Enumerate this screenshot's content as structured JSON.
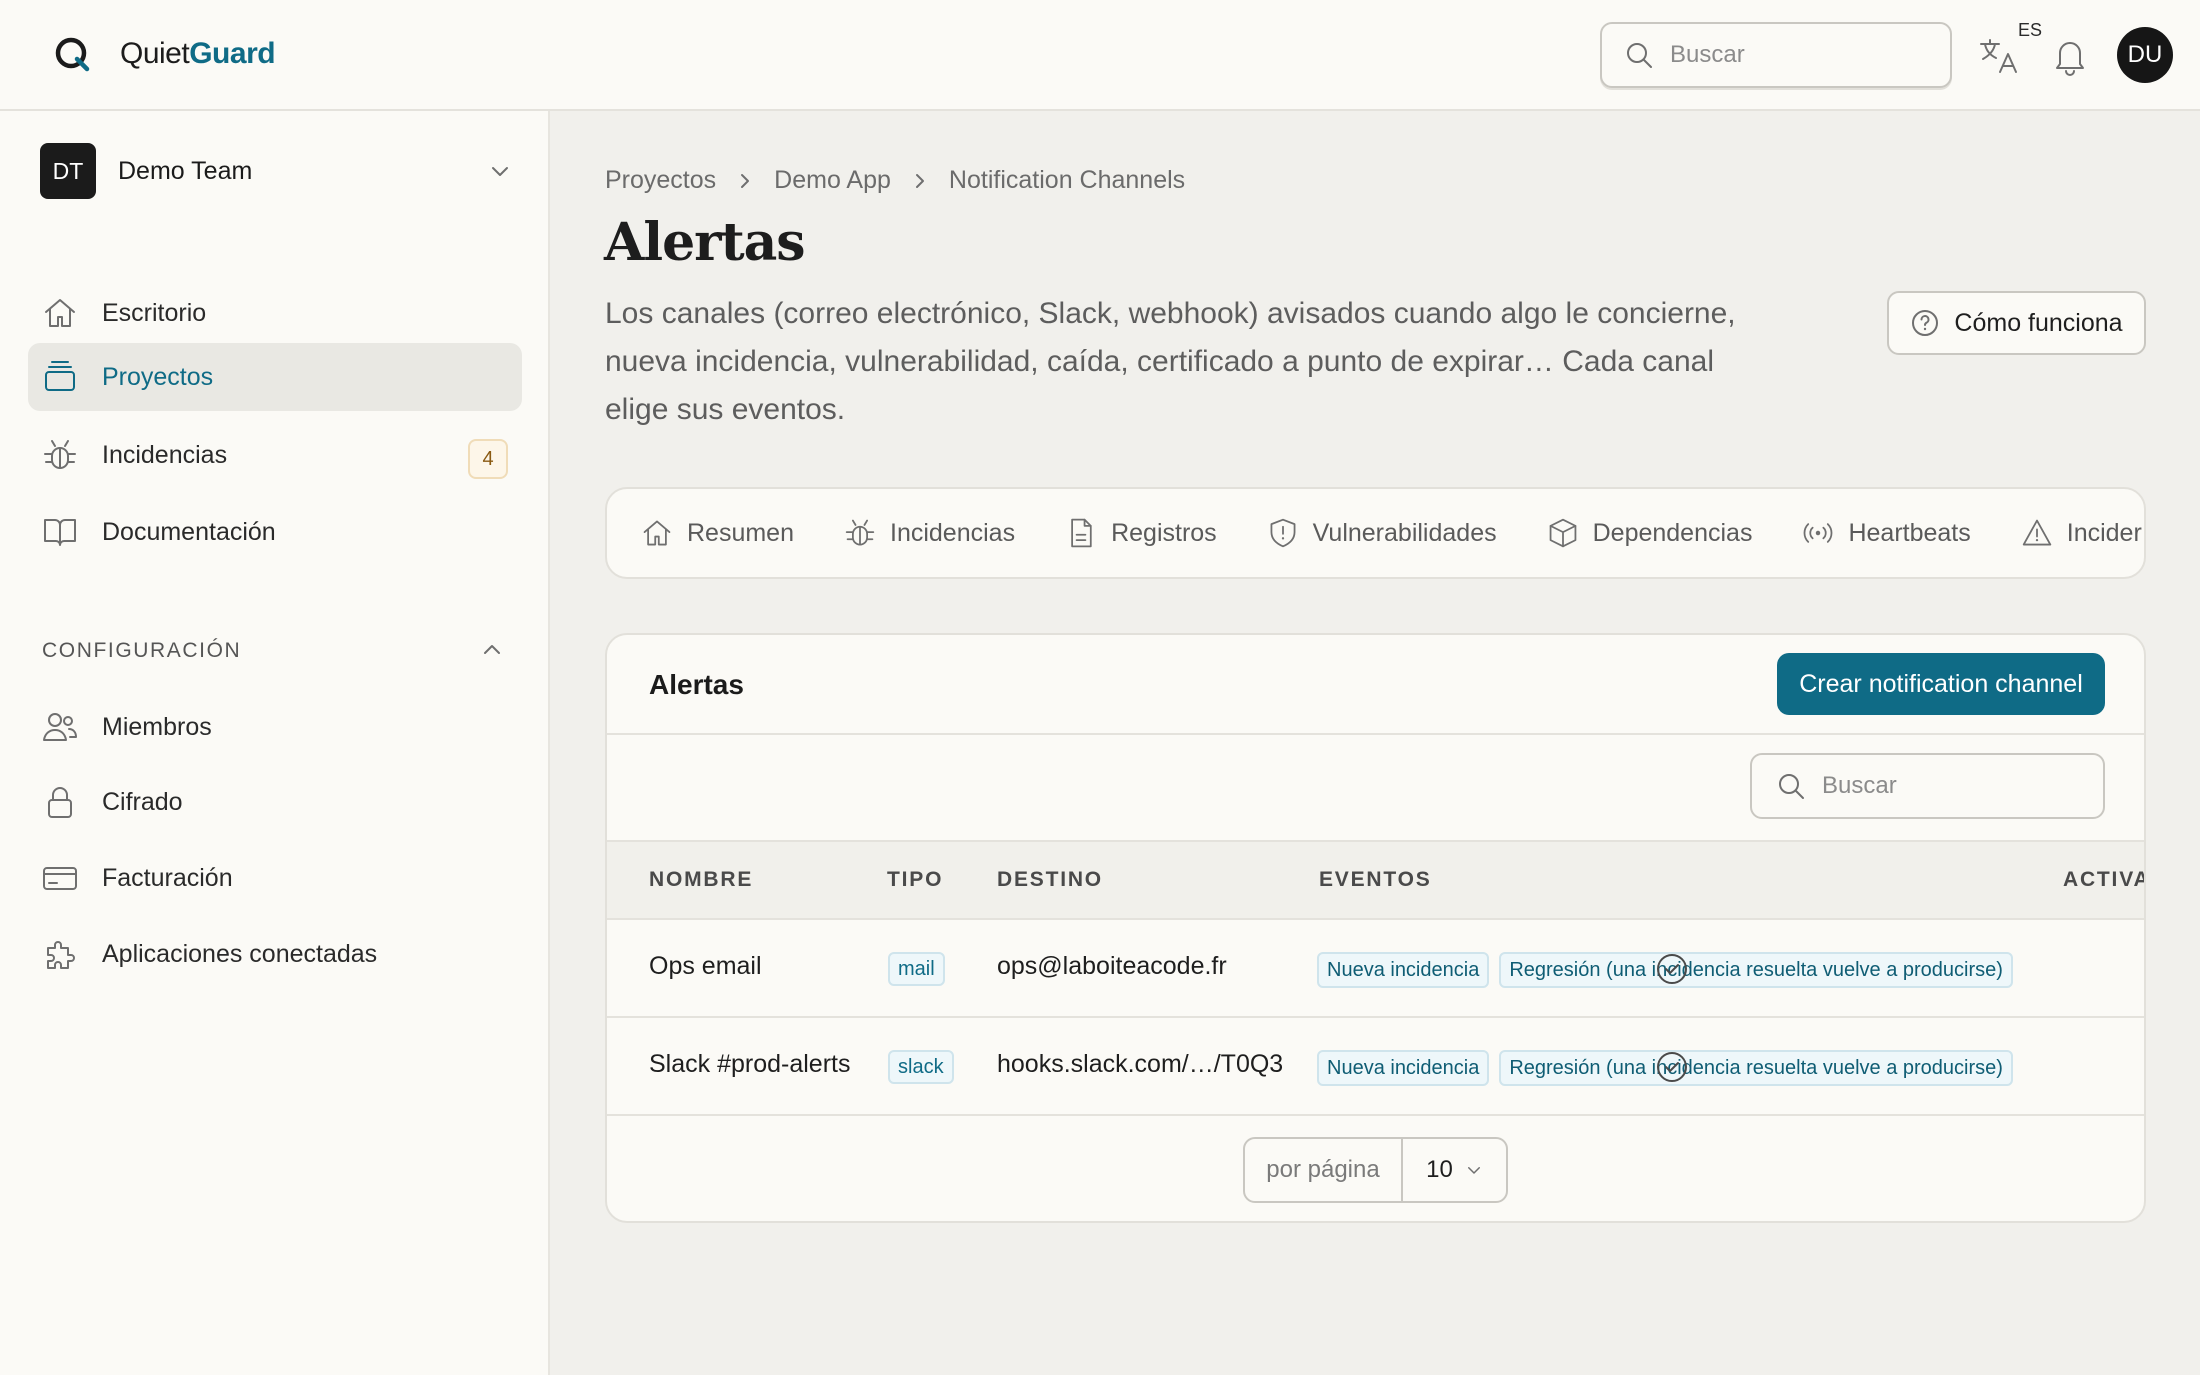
{
  "header": {
    "brand_prefix": "Quiet",
    "brand_suffix": "Guard",
    "search_placeholder": "Buscar",
    "language_code": "ES",
    "user_initials": "DU"
  },
  "sidebar": {
    "team_initials": "DT",
    "team_name": "Demo Team",
    "nav": [
      {
        "label": "Escritorio",
        "icon": "home-icon"
      },
      {
        "label": "Proyectos",
        "icon": "projects-icon",
        "active": true
      },
      {
        "label": "Incidencias",
        "icon": "bug-icon",
        "badge": "4"
      },
      {
        "label": "Documentación",
        "icon": "book-icon"
      }
    ],
    "config_title": "CONFIGURACIÓN",
    "config_items": [
      {
        "label": "Miembros",
        "icon": "members-icon"
      },
      {
        "label": "Cifrado",
        "icon": "lock-icon"
      },
      {
        "label": "Facturación",
        "icon": "credit-card-icon"
      },
      {
        "label": "Aplicaciones conectadas",
        "icon": "puzzle-icon"
      }
    ]
  },
  "main": {
    "breadcrumb": [
      "Proyectos",
      "Demo App",
      "Notification Channels"
    ],
    "title": "Alertas",
    "description": "Los canales (correo electrónico, Slack, webhook) avisados cuando algo le concierne, nueva incidencia, vulnerabilidad, caída, certificado a punto de expirar… Cada canal elige sus eventos.",
    "how_it_works_label": "Cómo funciona",
    "tabs": [
      {
        "label": "Resumen",
        "icon": "home-icon"
      },
      {
        "label": "Incidencias",
        "icon": "bug-icon"
      },
      {
        "label": "Registros",
        "icon": "file-icon"
      },
      {
        "label": "Vulnerabilidades",
        "icon": "shield-icon"
      },
      {
        "label": "Dependencias",
        "icon": "package-icon"
      },
      {
        "label": "Heartbeats",
        "icon": "broadcast-icon"
      },
      {
        "label": "Incider",
        "icon": "warning-icon"
      }
    ]
  },
  "card": {
    "title": "Alertas",
    "create_label": "Crear notification channel",
    "search_placeholder": "Buscar",
    "columns": [
      "NOMBRE",
      "TIPO",
      "DESTINO",
      "EVENTOS",
      "ACTIVA"
    ],
    "rows": [
      {
        "name": "Ops email",
        "type": "mail",
        "destination": "ops@laboiteacode.fr",
        "events": [
          "Nueva incidencia",
          "Regresión (una incidencia resuelta vuelve a producirse)"
        ],
        "active": true
      },
      {
        "name": "Slack #prod-alerts",
        "type": "slack",
        "destination": "hooks.slack.com/…/T0Q3",
        "events": [
          "Nueva incidencia",
          "Regresión (una incidencia resuelta vuelve a producirse)"
        ],
        "active": true
      }
    ],
    "per_page_label": "por página",
    "per_page_value": "10"
  },
  "colors": {
    "accent": "#0f6b86",
    "background": "#f1f0ec",
    "surface": "#fbfaf6"
  }
}
